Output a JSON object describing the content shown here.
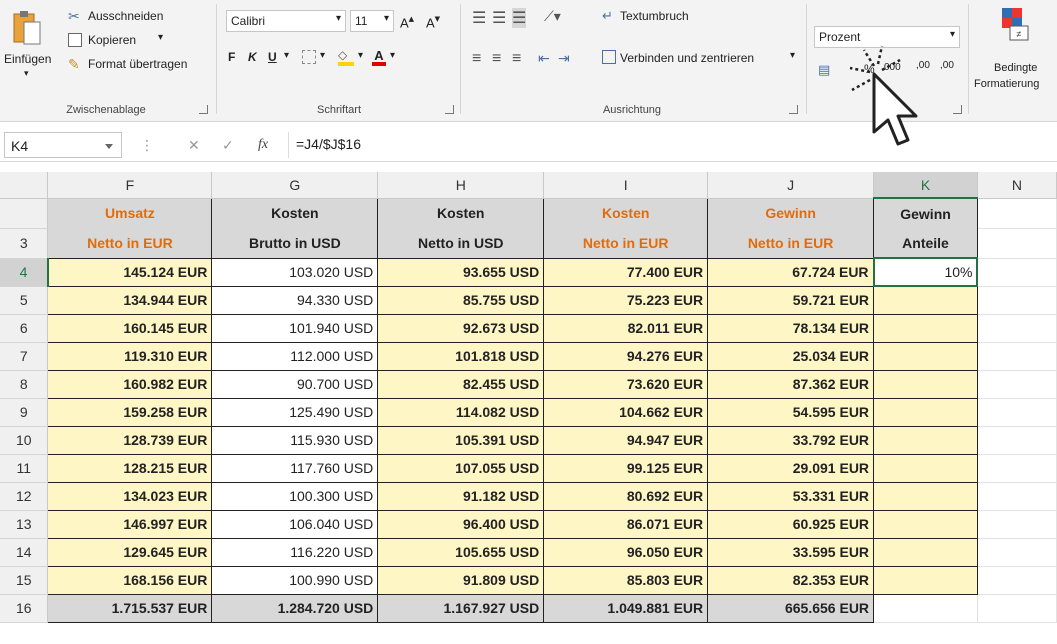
{
  "ribbon": {
    "clipboard": {
      "paste": "Einfügen",
      "cut": "Ausschneiden",
      "copy": "Kopieren",
      "format_painter": "Format übertragen",
      "label": "Zwischenablage"
    },
    "font": {
      "font_name": "Calibri",
      "font_size": "11",
      "bold": "F",
      "italic": "K",
      "underline": "U",
      "label": "Schriftart"
    },
    "alignment": {
      "wrap_text": "Textumbruch",
      "merge_center": "Verbinden und zentrieren",
      "label": "Ausrichtung"
    },
    "number": {
      "format": "Prozent"
    },
    "styles": {
      "conditional_line1": "Bedingte",
      "conditional_line2": "Formatierung"
    }
  },
  "formula_bar": {
    "name_box": "K4",
    "fx": "fx",
    "formula": "=J4/$J$16"
  },
  "grid": {
    "columns": [
      "F",
      "G",
      "H",
      "I",
      "J",
      "K",
      "N"
    ],
    "selected_column": "K",
    "header_row_number": "3",
    "headers_top": [
      "Umsatz",
      "Kosten",
      "Kosten",
      "Kosten",
      "Gewinn",
      "Gewinn"
    ],
    "headers_bottom": [
      "Netto in EUR",
      "Brutto in USD",
      "Netto in USD",
      "Netto in EUR",
      "Netto in EUR",
      "Anteile"
    ],
    "header_colors": [
      "orange",
      "dark",
      "dark",
      "orange",
      "orange",
      "dark"
    ],
    "rows": [
      {
        "num": "4",
        "cells": [
          "145.124 EUR",
          "103.020 USD",
          "93.655 USD",
          "77.400 EUR",
          "67.724 EUR",
          "10%"
        ]
      },
      {
        "num": "5",
        "cells": [
          "134.944 EUR",
          "94.330 USD",
          "85.755 USD",
          "75.223 EUR",
          "59.721 EUR",
          ""
        ]
      },
      {
        "num": "6",
        "cells": [
          "160.145 EUR",
          "101.940 USD",
          "92.673 USD",
          "82.011 EUR",
          "78.134 EUR",
          ""
        ]
      },
      {
        "num": "7",
        "cells": [
          "119.310 EUR",
          "112.000 USD",
          "101.818 USD",
          "94.276 EUR",
          "25.034 EUR",
          ""
        ]
      },
      {
        "num": "8",
        "cells": [
          "160.982 EUR",
          "90.700 USD",
          "82.455 USD",
          "73.620 EUR",
          "87.362 EUR",
          ""
        ]
      },
      {
        "num": "9",
        "cells": [
          "159.258 EUR",
          "125.490 USD",
          "114.082 USD",
          "104.662 EUR",
          "54.595 EUR",
          ""
        ]
      },
      {
        "num": "10",
        "cells": [
          "128.739 EUR",
          "115.930 USD",
          "105.391 USD",
          "94.947 EUR",
          "33.792 EUR",
          ""
        ]
      },
      {
        "num": "11",
        "cells": [
          "128.215 EUR",
          "117.760 USD",
          "107.055 USD",
          "99.125 EUR",
          "29.091 EUR",
          ""
        ]
      },
      {
        "num": "12",
        "cells": [
          "134.023 EUR",
          "100.300 USD",
          "91.182 USD",
          "80.692 EUR",
          "53.331 EUR",
          ""
        ]
      },
      {
        "num": "13",
        "cells": [
          "146.997 EUR",
          "106.040 USD",
          "96.400 USD",
          "86.071 EUR",
          "60.925 EUR",
          ""
        ]
      },
      {
        "num": "14",
        "cells": [
          "129.645 EUR",
          "116.220 USD",
          "105.655 USD",
          "96.050 EUR",
          "33.595 EUR",
          ""
        ]
      },
      {
        "num": "15",
        "cells": [
          "168.156 EUR",
          "100.990 USD",
          "91.809 USD",
          "85.803 EUR",
          "82.353 EUR",
          ""
        ]
      }
    ],
    "total_row": {
      "num": "16",
      "cells": [
        "1.715.537 EUR",
        "1.284.720 USD",
        "1.167.927 USD",
        "1.049.881 EUR",
        "665.656 EUR",
        ""
      ]
    }
  },
  "colors": {
    "accent": "#217346",
    "orange_header": "#e36c0a",
    "data_fill": "#fff6c6",
    "header_fill": "#d8d8d8"
  }
}
